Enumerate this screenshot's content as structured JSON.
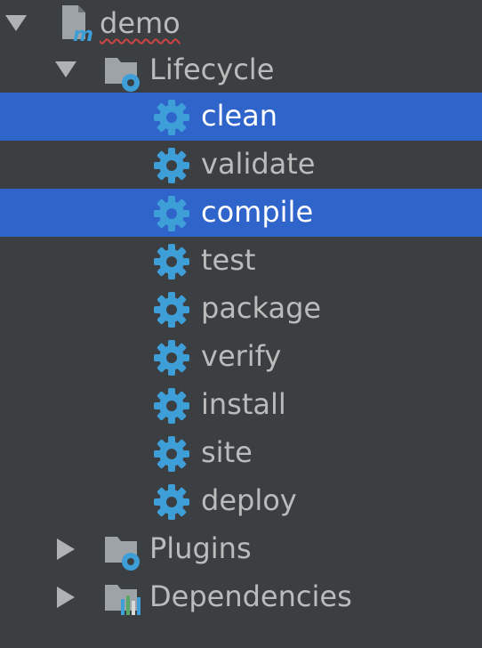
{
  "tree": {
    "root": {
      "label": "demo",
      "expanded": true,
      "icon": "maven-module-icon"
    },
    "lifecycle": {
      "label": "Lifecycle",
      "expanded": true,
      "icon": "lifecycle-folder-icon",
      "items": [
        {
          "label": "clean",
          "selected": true
        },
        {
          "label": "validate",
          "selected": false
        },
        {
          "label": "compile",
          "selected": true
        },
        {
          "label": "test",
          "selected": false
        },
        {
          "label": "package",
          "selected": false
        },
        {
          "label": "verify",
          "selected": false
        },
        {
          "label": "install",
          "selected": false
        },
        {
          "label": "site",
          "selected": false
        },
        {
          "label": "deploy",
          "selected": false
        }
      ]
    },
    "plugins": {
      "label": "Plugins",
      "expanded": false,
      "icon": "plugins-folder-icon"
    },
    "dependencies": {
      "label": "Dependencies",
      "expanded": false,
      "icon": "dependencies-folder-icon"
    }
  },
  "colors": {
    "background": "#3c3f41",
    "selection": "#2f65ca",
    "text": "#bbbbbb",
    "selected_text": "#ffffff",
    "gear": "#3e9ed8"
  }
}
